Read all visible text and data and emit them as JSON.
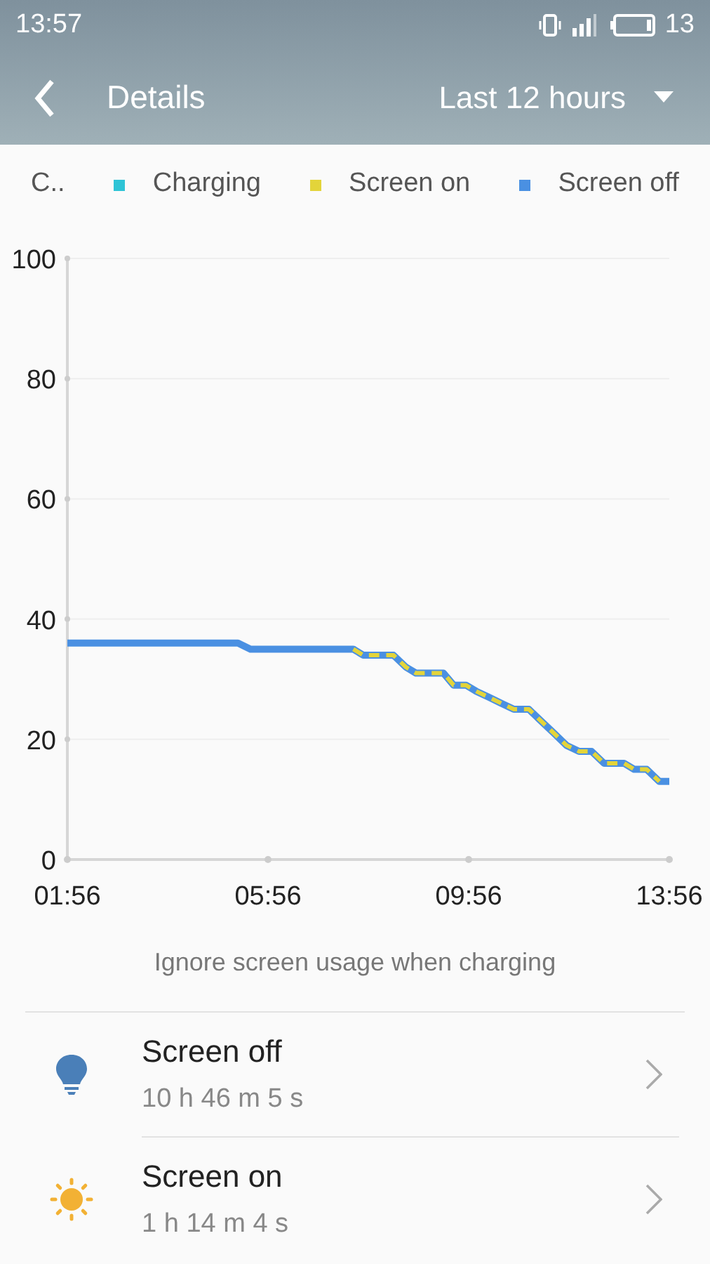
{
  "status_bar": {
    "time": "13:57",
    "battery_percent": "13"
  },
  "header": {
    "title": "Details",
    "range": "Last 12 hours"
  },
  "legend": [
    {
      "label": "C..",
      "kind": "text"
    },
    {
      "label": "Charging",
      "kind": "swatch",
      "color": "#2ec4d6"
    }
  ],
  "chart_data": {
    "type": "line",
    "grid": true,
    "x": [
      1.93,
      5.33,
      5.58,
      7.63,
      7.83,
      8.43,
      8.68,
      8.88,
      9.43,
      9.63,
      9.88,
      10.08,
      10.33,
      10.58,
      10.83,
      11.13,
      11.38,
      11.63,
      11.88,
      12.13,
      12.38,
      12.63,
      13.03,
      13.23,
      13.48,
      13.73,
      13.93
    ],
    "series": [
      {
        "name": "Screen on",
        "color": "#e3d43a",
        "line_style": "dashed",
        "values": [
          null,
          null,
          null,
          35,
          34,
          34,
          32,
          31,
          31,
          29,
          29,
          28,
          27,
          26,
          25,
          25,
          23,
          21,
          19,
          18,
          18,
          16,
          16,
          15,
          15,
          13,
          null
        ]
      },
      {
        "name": "Screen off",
        "color": "#4a90e2",
        "line_style": "solid",
        "values": [
          36,
          36,
          35,
          35,
          34,
          34,
          32,
          31,
          31,
          29,
          29,
          28,
          27,
          26,
          25,
          25,
          23,
          21,
          19,
          18,
          18,
          16,
          16,
          15,
          15,
          13,
          13
        ]
      }
    ],
    "xlim": [
      1.93,
      13.93
    ],
    "ylim": [
      0,
      100
    ],
    "xticks": [
      {
        "value": 1.93,
        "label": "01:56"
      },
      {
        "value": 5.93,
        "label": "05:56"
      },
      {
        "value": 9.93,
        "label": "09:56"
      },
      {
        "value": 13.93,
        "label": "13:56"
      }
    ],
    "yticks": [
      0,
      20,
      40,
      60,
      80,
      100
    ]
  },
  "caption": "Ignore screen usage when charging",
  "items": [
    {
      "kind": "bulb",
      "title": "Screen off",
      "duration": "10 h 46 m 5 s"
    },
    {
      "kind": "sun",
      "title": "Screen on",
      "duration": "1 h 14 m 4 s"
    }
  ]
}
